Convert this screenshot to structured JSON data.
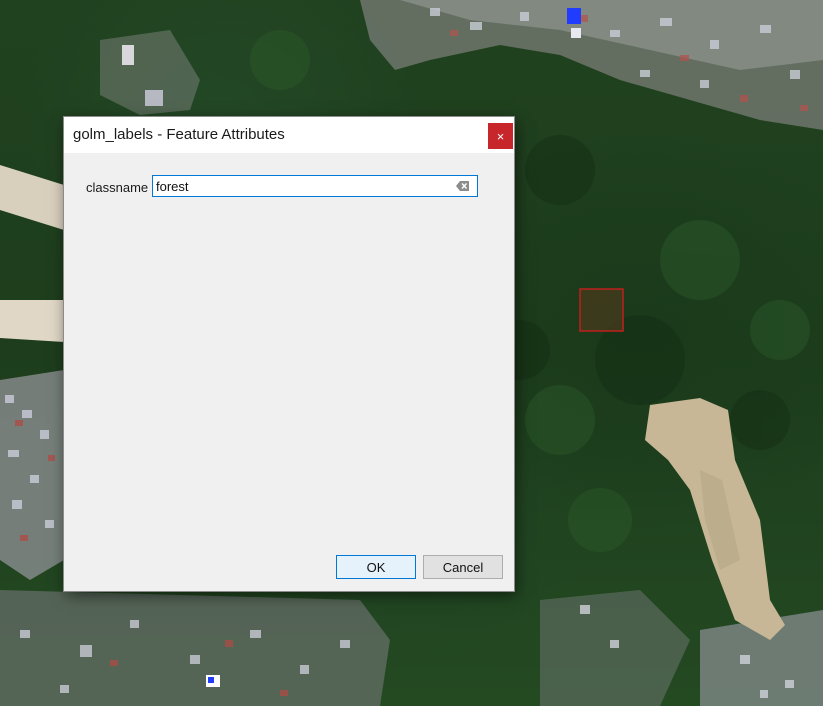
{
  "dialog": {
    "title": "golm_labels - Feature Attributes",
    "close_symbol": "×",
    "close_icon": "close-icon",
    "field_label": "classname",
    "field_value": "forest",
    "clear_icon": "clear-text-icon",
    "ok_label": "OK",
    "cancel_label": "Cancel"
  },
  "colors": {
    "close_button": "#c7262b",
    "input_focus_border": "#0078d7",
    "feature_outline": "#c0201c",
    "dialog_background": "#f0f0f0"
  }
}
